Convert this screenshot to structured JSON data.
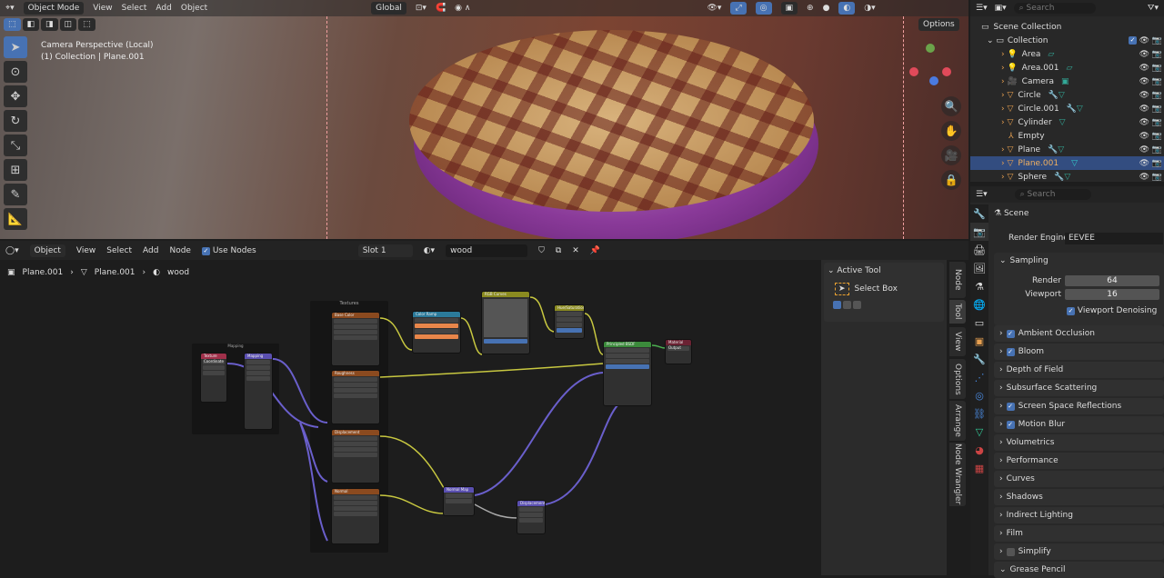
{
  "viewport": {
    "header": {
      "mode": "Object Mode",
      "menus": [
        "View",
        "Select",
        "Add",
        "Object"
      ],
      "orientation": "Global",
      "options": "Options"
    },
    "overlay": {
      "line1": "Camera Perspective (Local)",
      "line2": "(1) Collection | Plane.001"
    },
    "tools": [
      "select-box",
      "cursor",
      "move",
      "rotate",
      "scale",
      "transform",
      "annotate",
      "measure"
    ]
  },
  "node_editor": {
    "header": {
      "type": "Object",
      "menus": [
        "View",
        "Select",
        "Add",
        "Node"
      ],
      "use_nodes": "Use Nodes",
      "slot": "Slot 1",
      "material": "wood"
    },
    "breadcrumb": [
      "Plane.001",
      "Plane.001",
      "wood"
    ],
    "nodes": {
      "frame": "Textures",
      "mapping_frame": "Mapping",
      "texcoord": "Texture Coordinate",
      "mapping": "Mapping",
      "base_color": "Base Color",
      "roughness": "Roughness",
      "displacement_tex": "Displacement",
      "normal_tex": "Normal",
      "color_ramp": "Color Ramp",
      "rgb_curves": "RGB Curves",
      "hsv": "Hue/Saturation/Value",
      "bsdf": "Principled BSDF",
      "output": "Material Output",
      "normal_map": "Normal Map",
      "displacement": "Displacement"
    },
    "sidebar": {
      "panel": "Active Tool",
      "tool": "Select Box",
      "tabs": [
        "Node",
        "Tool",
        "View",
        "Options",
        "Arrange",
        "Node Wrangler"
      ]
    }
  },
  "outliner": {
    "search_placeholder": "Search",
    "scene_collection": "Scene Collection",
    "collection": "Collection",
    "items": [
      {
        "name": "Area",
        "type": "light"
      },
      {
        "name": "Area.001",
        "type": "light"
      },
      {
        "name": "Camera",
        "type": "camera"
      },
      {
        "name": "Circle",
        "type": "mesh"
      },
      {
        "name": "Circle.001",
        "type": "mesh"
      },
      {
        "name": "Cylinder",
        "type": "mesh"
      },
      {
        "name": "Empty",
        "type": "empty"
      },
      {
        "name": "Plane",
        "type": "mesh"
      },
      {
        "name": "Plane.001",
        "type": "mesh",
        "selected": true
      },
      {
        "name": "Sphere",
        "type": "mesh"
      }
    ]
  },
  "properties": {
    "search_placeholder": "Search",
    "context": "Scene",
    "render_engine_label": "Render Engine",
    "render_engine": "EEVEE",
    "sampling": {
      "label": "Sampling",
      "render_label": "Render",
      "render": "64",
      "viewport_label": "Viewport",
      "viewport": "16",
      "denoise": "Viewport Denoising"
    },
    "panels": [
      {
        "label": "Ambient Occlusion",
        "checked": true
      },
      {
        "label": "Bloom",
        "checked": true
      },
      {
        "label": "Depth of Field"
      },
      {
        "label": "Subsurface Scattering"
      },
      {
        "label": "Screen Space Reflections",
        "checked": true
      },
      {
        "label": "Motion Blur",
        "checked": true
      },
      {
        "label": "Volumetrics"
      },
      {
        "label": "Performance"
      },
      {
        "label": "Curves"
      },
      {
        "label": "Shadows"
      },
      {
        "label": "Indirect Lighting"
      },
      {
        "label": "Film"
      },
      {
        "label": "Simplify",
        "checked": false
      },
      {
        "label": "Grease Pencil",
        "expanded": true
      }
    ]
  },
  "colors": {
    "accent": "#4772b3",
    "selected_row": "#334d80",
    "texture_header": "#8b4a1f",
    "shader_header": "#3b8a3b",
    "output_header": "#6b2233",
    "vector_header": "#5a4fb0",
    "converter_header": "#2b7a9a",
    "color_header": "#8a8a20"
  }
}
